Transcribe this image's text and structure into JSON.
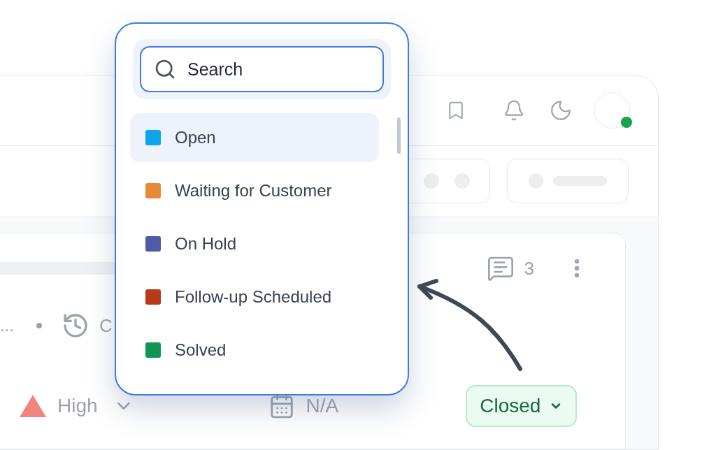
{
  "dropdown": {
    "search": {
      "placeholder": "Search"
    },
    "options": [
      {
        "label": "Open",
        "color": "#0ea5e9",
        "selected": true
      },
      {
        "label": "Waiting for Customer",
        "color": "#e88a35",
        "selected": false
      },
      {
        "label": "On Hold",
        "color": "#4f5aa8",
        "selected": false
      },
      {
        "label": "Follow-up Scheduled",
        "color": "#b83a17",
        "selected": false
      },
      {
        "label": "Solved",
        "color": "#109653",
        "selected": false
      }
    ]
  },
  "header": {
    "avatar_online": true
  },
  "ticket": {
    "comment_count": "3",
    "meta_truncated": "...",
    "meta_cut": "C",
    "priority": "High",
    "due_date": "N/A",
    "status": "Closed"
  }
}
